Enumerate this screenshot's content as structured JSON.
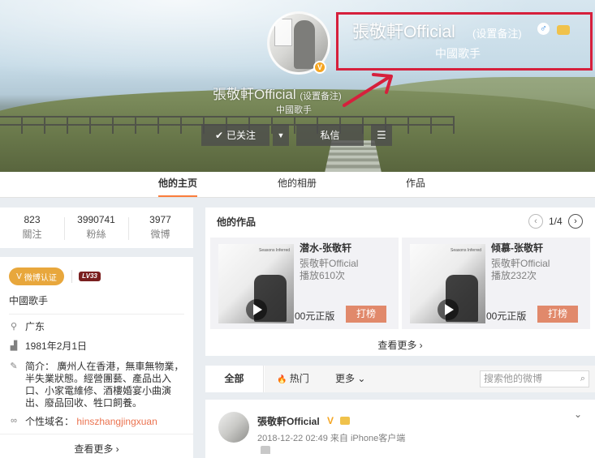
{
  "profile": {
    "name": "張敬軒Official",
    "remark": "(设置备注)",
    "title": "中國歌手",
    "gender_symbol": "♂",
    "verify_symbol": "V"
  },
  "actions": {
    "follow": "已关注",
    "follow_check": "✔",
    "dropdown": "▼",
    "message": "私信",
    "menu": "☰"
  },
  "nav": {
    "tabs": [
      "他的主页",
      "他的相册",
      "作品"
    ]
  },
  "stats": [
    {
      "num": "823",
      "label": "關注"
    },
    {
      "num": "3990741",
      "label": "粉絲"
    },
    {
      "num": "3977",
      "label": "微博"
    }
  ],
  "info": {
    "verified_label": "微博认证",
    "level": "LV33",
    "title": "中國歌手",
    "location": "广东",
    "birthday": "1981年2月1日",
    "bio": "简介： 廣州人在香港，無車無物業，半失業狀態。經營團藝、產品出入口、小家電維修、酒樓婚宴小曲演出、廢品回收、牲口飼養。",
    "domain_label": "个性域名：",
    "domain": "hinszhangjingxuan",
    "more": "查看更多 ›"
  },
  "works": {
    "title": "他的作品",
    "pager": "1/4",
    "prev": "‹",
    "next": "›",
    "more": "查看更多 ›",
    "items": [
      {
        "song": "潜水-张敬轩",
        "artist": "張敬軒Official",
        "plays": "播放610次",
        "price": "00元正版",
        "action": "打榜",
        "cover_text": "Seasons Inferred"
      },
      {
        "song": "倾慕-张敬轩",
        "artist": "張敬軒Official",
        "plays": "播放232次",
        "price": "00元正版",
        "action": "打榜",
        "cover_text": "Seasons Inferred"
      }
    ]
  },
  "feed": {
    "tabs": {
      "all": "全部",
      "hot": "热门",
      "more": "更多"
    },
    "hot_icon": "🔥",
    "more_caret": "⌄",
    "search_placeholder": "搜索他的微博",
    "search_icon": "⌕"
  },
  "post": {
    "author": "張敬軒Official",
    "verify": "V",
    "meta": "2018-12-22 02:49 来自 iPhone客户端",
    "chevron": "⌄"
  },
  "colors": {
    "accent_orange": "#fa7d3c",
    "highlight_red": "#d6203c",
    "verify_gold": "#e8a73c",
    "hit_button": "#e1896b",
    "domain_link": "#eb7350"
  }
}
